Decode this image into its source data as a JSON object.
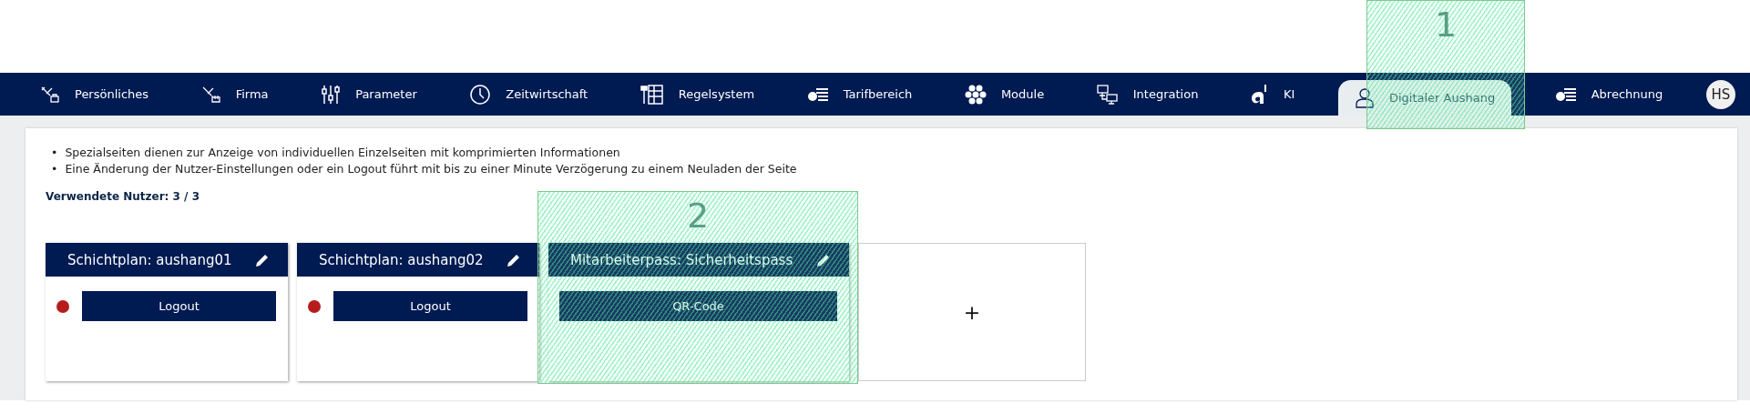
{
  "nav": {
    "items": [
      {
        "label": "Persönliches",
        "selected": false
      },
      {
        "label": "Firma",
        "selected": false
      },
      {
        "label": "Parameter",
        "selected": false
      },
      {
        "label": "Zeitwirtschaft",
        "selected": false
      },
      {
        "label": "Regelsystem",
        "selected": false
      },
      {
        "label": "Tarifbereich",
        "selected": false
      },
      {
        "label": "Module",
        "selected": false
      },
      {
        "label": "Integration",
        "selected": false
      },
      {
        "label": "KI",
        "selected": false
      },
      {
        "label": "Digitaler Aushang",
        "selected": true
      },
      {
        "label": "Abrechnung",
        "selected": false
      }
    ],
    "avatar": "HS"
  },
  "notes": [
    {
      "bullet": "•",
      "text": "Spezialseiten dienen zur Anzeige von individuellen Einzelseiten mit komprimierten Informationen"
    },
    {
      "bullet": "•",
      "text": "Eine Änderung der Nutzer-Einstellungen oder ein Logout führt mit bis zu einer Minute Verzögerung zu einem Neuladen der Seite"
    }
  ],
  "usage": "Verwendete Nutzer: 3 / 3",
  "cards": [
    {
      "kind": "page",
      "title": "Schichtplan: aushang01",
      "color": "#b71c1c",
      "button": "Logout"
    },
    {
      "kind": "page",
      "title": "Schichtplan: aushang02",
      "color": "#b71c1c",
      "button": "Logout"
    },
    {
      "kind": "page",
      "title": "Mitarbeiterpass: Sicherheitspass",
      "button": "QR-Code"
    },
    {
      "kind": "add",
      "label": "+"
    }
  ],
  "callouts": [
    "1",
    "2"
  ]
}
